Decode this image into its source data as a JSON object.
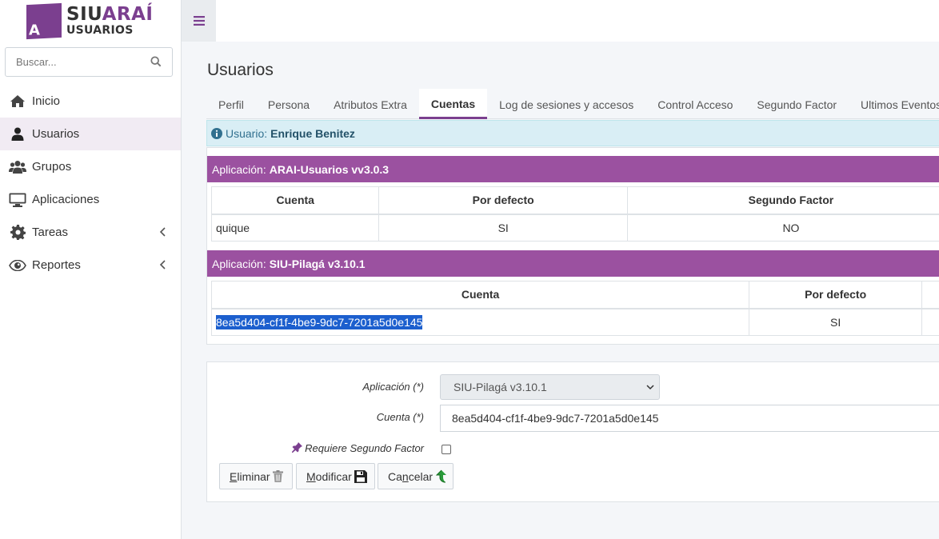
{
  "brand": {
    "title_a": "SIU",
    "title_b": "ARAÍ",
    "subtitle": "USUARIOS",
    "logo_letter": "A"
  },
  "search": {
    "placeholder": "Buscar..."
  },
  "nav": [
    {
      "label": "Inicio",
      "icon": "home-icon"
    },
    {
      "label": "Usuarios",
      "icon": "user-icon",
      "active": true
    },
    {
      "label": "Grupos",
      "icon": "users-icon"
    },
    {
      "label": "Aplicaciones",
      "icon": "monitor-icon"
    },
    {
      "label": "Tareas",
      "icon": "gear-icon"
    },
    {
      "label": "Reportes",
      "icon": "eye-icon"
    }
  ],
  "page": {
    "title": "Usuarios"
  },
  "tabs": [
    "Perfil",
    "Persona",
    "Atributos Extra",
    "Cuentas",
    "Log de sesiones y accesos",
    "Control Acceso",
    "Segundo Factor",
    "Ultimos Eventos"
  ],
  "active_tab": "Cuentas",
  "info": {
    "label": "Usuario:",
    "value": "Enrique Benitez"
  },
  "apps": [
    {
      "label": "Aplicación:",
      "name": "ARAI-Usuarios vv3.0.3",
      "columns": [
        "Cuenta",
        "Por defecto",
        "Segundo Factor"
      ],
      "rows": [
        [
          "quique",
          "SI",
          "NO"
        ]
      ]
    },
    {
      "label": "Aplicación:",
      "name": "SIU-Pilagá v3.10.1",
      "columns": [
        "Cuenta",
        "Por defecto"
      ],
      "rows": [
        [
          "8ea5d404-cf1f-4be9-9dc7-7201a5d0e145",
          "SI"
        ]
      ]
    }
  ],
  "form": {
    "app_label": "Aplicación (*)",
    "app_value": "SIU-Pilagá v3.10.1",
    "account_label": "Cuenta (*)",
    "account_value": "8ea5d404-cf1f-4be9-9dc7-7201a5d0e145",
    "second_factor_label": "Requiere Segundo Factor",
    "second_factor_checked": false
  },
  "buttons": {
    "delete_a": "E",
    "delete_b": "liminar",
    "modify_a": "M",
    "modify_b": "odificar",
    "cancel_a": "Ca",
    "cancel_u": "n",
    "cancel_b": "celar"
  },
  "colors": {
    "accent": "#7b3f8f",
    "app_header": "#9b51a0",
    "info_bg": "#d9eef5"
  }
}
